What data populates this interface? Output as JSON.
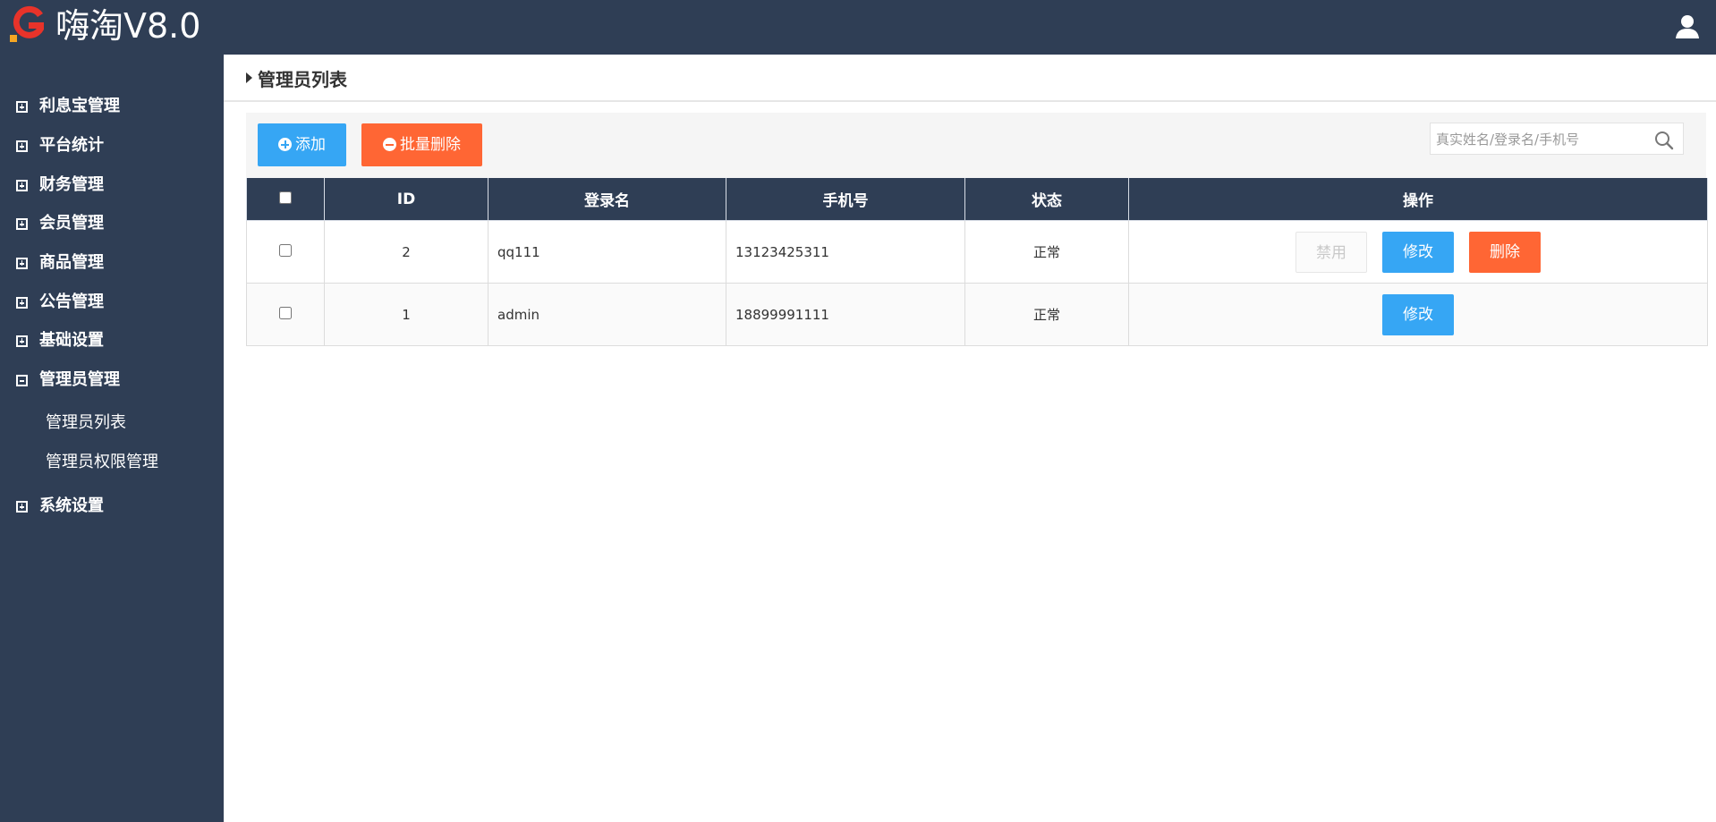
{
  "app": {
    "title": "嗨淘V8.0",
    "logo_icon": "g-logo-icon",
    "user_icon": "user-icon"
  },
  "colors": {
    "header_bg": "#2f3e55",
    "primary": "#36a6f4",
    "danger": "#ff6634"
  },
  "sidebar": {
    "items": [
      {
        "label": "利息宝管理",
        "expanded": false
      },
      {
        "label": "平台统计",
        "expanded": false
      },
      {
        "label": "财务管理",
        "expanded": false
      },
      {
        "label": "会员管理",
        "expanded": false
      },
      {
        "label": "商品管理",
        "expanded": false
      },
      {
        "label": "公告管理",
        "expanded": false
      },
      {
        "label": "基础设置",
        "expanded": false
      },
      {
        "label": "管理员管理",
        "expanded": true
      },
      {
        "label": "系统设置",
        "expanded": false
      }
    ],
    "subitems": [
      {
        "label": "管理员列表"
      },
      {
        "label": "管理员权限管理"
      }
    ]
  },
  "page": {
    "title": "管理员列表"
  },
  "toolbar": {
    "add_label": "添加",
    "batch_delete_label": "批量删除",
    "search_placeholder": "真实姓名/登录名/手机号",
    "search_value": ""
  },
  "table": {
    "columns": [
      "",
      "ID",
      "登录名",
      "手机号",
      "状态",
      "操作"
    ],
    "rows": [
      {
        "id": "2",
        "login": "qq111",
        "phone": "13123425311",
        "status": "正常",
        "actions": {
          "disable": "禁用",
          "edit": "修改",
          "delete": "删除"
        }
      },
      {
        "id": "1",
        "login": "admin",
        "phone": "18899991111",
        "status": "正常",
        "actions": {
          "edit": "修改"
        }
      }
    ]
  }
}
